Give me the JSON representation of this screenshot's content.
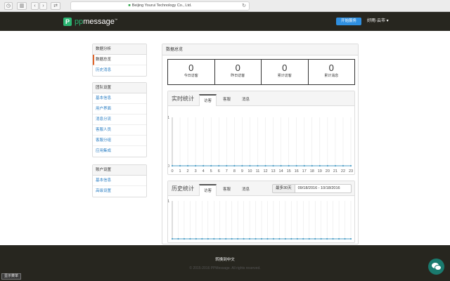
{
  "browser": {
    "url": "Beijing Yourui Technology Co., Ltd."
  },
  "header": {
    "logo_mark": "P",
    "logo_prefix": "pp",
    "logo_suffix": "message",
    "tm": "™",
    "start_button": "开始服务",
    "user": "好雨·云市",
    "user_caret": "▾"
  },
  "sidebar": {
    "sections": [
      {
        "title": "数据分析",
        "items": [
          "数据总览",
          "历史消息"
        ]
      },
      {
        "title": "团队设置",
        "items": [
          "基本信息",
          "用户界面",
          "消息分流",
          "客服人员",
          "客服分组",
          "应用集成"
        ]
      },
      {
        "title": "账户设置",
        "items": [
          "基本信息",
          "高级设置"
        ]
      }
    ],
    "active_item": "数据总览"
  },
  "main": {
    "title": "数据总览",
    "stats": [
      {
        "value": "0",
        "label": "今日访客"
      },
      {
        "value": "0",
        "label": "昨日访客"
      },
      {
        "value": "0",
        "label": "累计访客"
      },
      {
        "value": "0",
        "label": "累计消息"
      }
    ],
    "realtime": {
      "title": "实时统计",
      "tabs": [
        "访客",
        "客服",
        "消息"
      ],
      "active_tab": "访客"
    },
    "history": {
      "title": "历史统计",
      "tabs": [
        "访客",
        "客服",
        "消息"
      ],
      "active_tab": "访客",
      "range_prefix": "最多30天",
      "range_value": "09/18/2016 - 10/18/2016"
    }
  },
  "chart_data": [
    {
      "type": "line",
      "x": [
        0,
        1,
        2,
        3,
        4,
        5,
        6,
        7,
        8,
        9,
        10,
        11,
        12,
        13,
        14,
        15,
        16,
        17,
        18,
        19,
        20,
        21,
        22,
        23
      ],
      "series": [
        {
          "values": [
            0,
            0,
            0,
            0,
            0,
            0,
            0,
            0,
            0,
            0,
            0,
            0,
            0,
            0,
            0,
            0,
            0,
            0,
            0,
            0,
            0,
            0,
            0,
            0
          ]
        }
      ],
      "ylim": [
        0,
        1
      ],
      "yticks": [
        "0",
        "1"
      ],
      "grid": true,
      "color": "#4e9fc7"
    },
    {
      "type": "line",
      "points": 31,
      "series": [
        {
          "values": [
            0,
            0,
            0,
            0,
            0,
            0,
            0,
            0,
            0,
            0,
            0,
            0,
            0,
            0,
            0,
            0,
            0,
            0,
            0,
            0,
            0,
            0,
            0,
            0,
            0,
            0,
            0,
            0,
            0,
            0,
            0
          ]
        }
      ],
      "ylim": [
        0,
        1
      ],
      "yticks": [
        "1"
      ],
      "grid": true,
      "color": "#4e9fc7"
    }
  ],
  "footer": {
    "lang": "转换到中文",
    "copyright": "© 2015-2016 PPMessage. All rights reserved."
  },
  "menu_button": "显示菜单",
  "colors": {
    "brand": "#2bb673",
    "topbar": "#27261f",
    "accent": "#2f8fe0",
    "active": "#e0652c"
  }
}
